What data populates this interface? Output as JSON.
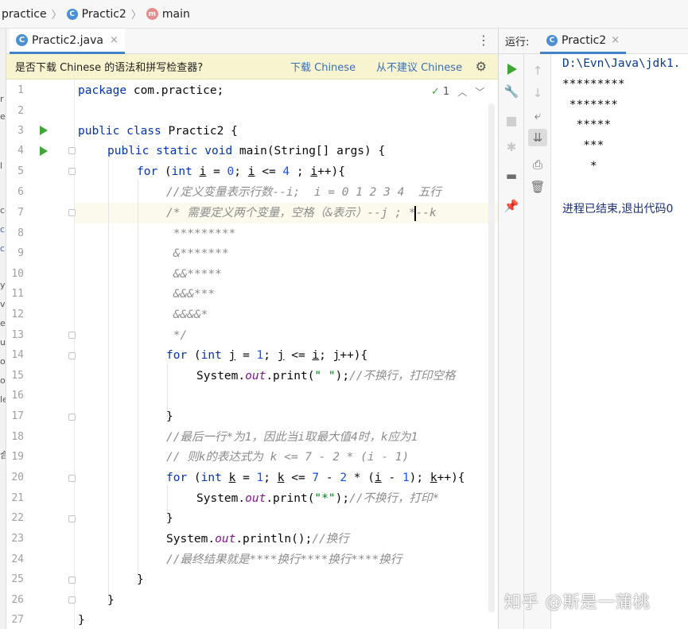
{
  "breadcrumb": {
    "project": "practice",
    "class_name": "Practic2",
    "class_icon_letter": "C",
    "method": "main",
    "method_icon_letter": "m"
  },
  "left_strip_fragments": [
    "r",
    "e",
    "l",
    "ce",
    "c",
    "c",
    "y",
    "v",
    "e",
    "ur",
    "oe",
    "oe",
    "le",
    "合"
  ],
  "editor_tab": {
    "label": "Practic2.java",
    "close": "×"
  },
  "more_menu": "⋮",
  "notification": {
    "message": "是否下载 Chinese 的语法和拼写检查器?",
    "download_link": "下载 Chinese",
    "dismiss_link": "从不建议 Chinese"
  },
  "inspection": {
    "count": "1",
    "check_glyph": "✓"
  },
  "line_numbers": [
    "1",
    "2",
    "3",
    "4",
    "5",
    "6",
    "7",
    "8",
    "9",
    "10",
    "11",
    "12",
    "13",
    "14",
    "15",
    "16",
    "17",
    "18",
    "19",
    "20",
    "21",
    "22",
    "23",
    "24",
    "25",
    "26",
    "27"
  ],
  "code": {
    "l1_package": "package",
    "l1_rest": " com.practice;",
    "l3_public": "public",
    "l3_class": "class",
    "l3_rest": " Practic2 {",
    "l4_public": "public",
    "l4_static": "static",
    "l4_void": "void",
    "l4_rest": " main(String[] args) {",
    "l5_for": "for",
    "l5_open": " (",
    "l5_int": "int",
    "l5_i1": "i",
    "l5_eq": " = ",
    "l5_zero": "0",
    "l5_semi": "; ",
    "l5_i2": "i",
    "l5_le": " <= ",
    "l5_four": "4",
    "l5_semi2": " ; ",
    "l5_i3": "i",
    "l5_tail": "++){",
    "l6": "//定义变量表示行数--i;  i = 0 1 2 3 4  五行",
    "l7": "/* 需要定义两个变量，空格（&表示）--j ; *--k",
    "l8": " *********",
    "l9": " &*******",
    "l10": " &&*****",
    "l11": " &&&***",
    "l12": " &&&&*",
    "l13": " */",
    "l14_for": "for",
    "l14_open": " (",
    "l14_int": "int",
    "l14_j1": "j",
    "l14_eq": " = ",
    "l14_one": "1",
    "l14_semi": "; ",
    "l14_j2": "j",
    "l14_le": " <= ",
    "l14_i": "i",
    "l14_semi2": "; ",
    "l14_j3": "j",
    "l14_tail": "++){",
    "l15_a": "System.",
    "l15_out": "out",
    "l15_b": ".print(",
    "l15_str": "\" \"",
    "l15_c": ");",
    "l15_cm": "//不换行，打印空格",
    "l17": "}",
    "l18": "//最后一行*为1，因此当i取最大值4时，k应为1",
    "l19": "// 则k的表达式为 k <= 7 - 2 * (i - 1)",
    "l20_for": "for",
    "l20_open": " (",
    "l20_int": "int",
    "l20_k1": "k",
    "l20_eq": " = ",
    "l20_one": "1",
    "l20_semi": "; ",
    "l20_k2": "k",
    "l20_le": " <= ",
    "l20_seven": "7",
    "l20_minus": " - ",
    "l20_two": "2",
    "l20_star": " * (",
    "l20_i": "i",
    "l20_minus2": " - ",
    "l20_one2": "1",
    "l20_close": "); ",
    "l20_k3": "k",
    "l20_tail": "++){",
    "l21_a": "System.",
    "l21_out": "out",
    "l21_b": ".print(",
    "l21_str": "\"*\"",
    "l21_c": ");",
    "l21_cm": "//不换行，打印*",
    "l22": "}",
    "l23_a": "System.",
    "l23_out": "out",
    "l23_b": ".println();",
    "l23_cm": "//换行",
    "l24": "//最终结果就是****换行****换行****换行",
    "l25": "}",
    "l26": "}",
    "l27": "}"
  },
  "run_panel": {
    "label": "运行:",
    "tab_label": "Practic2",
    "tab_close": "×"
  },
  "console": {
    "path": "D:\\Evn\\Java\\jdk1.",
    "lines": [
      "*********",
      " *******",
      "  *****",
      "   ***",
      "    *"
    ],
    "exit_message": "进程已结束,退出代码0"
  },
  "watermark": "知乎 @斯是一蒲桃"
}
